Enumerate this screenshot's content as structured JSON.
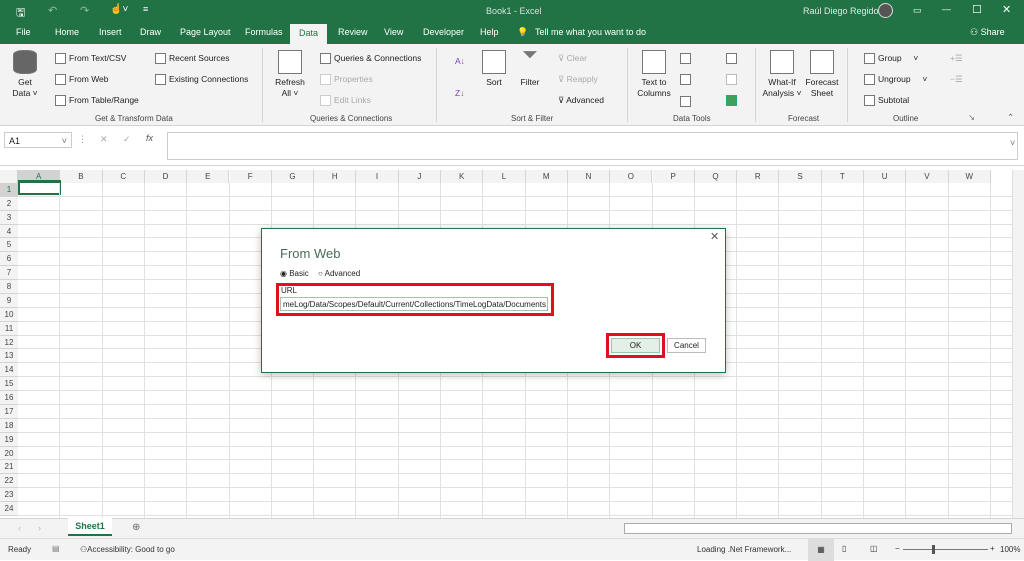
{
  "title": {
    "document": "Book1  -  Excel",
    "user": "Raúl Diego Regidor"
  },
  "tabs": [
    "File",
    "Home",
    "Insert",
    "Draw",
    "Page Layout",
    "Formulas",
    "Data",
    "Review",
    "View",
    "Developer",
    "Help"
  ],
  "tell_me": "Tell me what you want to do",
  "share": "Share",
  "ribbon": {
    "get_data": "Get Data ˅",
    "from_text": "From Text/CSV",
    "from_web": "From Web",
    "from_table": "From Table/Range",
    "recent": "Recent Sources",
    "existing": "Existing Connections",
    "g_transform": "Get & Transform Data",
    "refresh": "Refresh All ˅",
    "queries": "Queries & Connections",
    "properties": "Properties",
    "edit_links": "Edit Links",
    "g_queries": "Queries & Connections",
    "sort": "Sort",
    "filter": "Filter",
    "clear": "Clear",
    "reapply": "Reapply",
    "advanced": "Advanced",
    "g_sort": "Sort & Filter",
    "text_to_columns": "Text to Columns",
    "g_tools": "Data Tools",
    "whatif": "What-If Analysis ˅",
    "forecast_sheet": "Forecast Sheet",
    "g_forecast": "Forecast",
    "group": "Group",
    "ungroup": "Ungroup",
    "subtotal": "Subtotal",
    "g_outline": "Outline"
  },
  "namebox": "A1",
  "columns": [
    "A",
    "B",
    "C",
    "D",
    "E",
    "F",
    "G",
    "H",
    "I",
    "J",
    "K",
    "L",
    "M",
    "N",
    "O",
    "P",
    "Q",
    "R",
    "S",
    "T",
    "U",
    "V",
    "W"
  ],
  "rows": [
    "1",
    "2",
    "3",
    "4",
    "5",
    "6",
    "7",
    "8",
    "9",
    "10",
    "11",
    "12",
    "13",
    "14",
    "15",
    "16",
    "17",
    "18",
    "19",
    "20",
    "21",
    "22",
    "23",
    "24"
  ],
  "sheet_tab": "Sheet1",
  "status": {
    "ready": "Ready",
    "accessibility": "Accessibility: Good to go",
    "loading": "Loading .Net Framework...",
    "zoom": "100%"
  },
  "dialog": {
    "title": "From Web",
    "basic": "Basic",
    "advanced": "Advanced",
    "url_label": "URL",
    "url_value": "meLog/Data/Scopes/Default/Current/Collections/TimeLogData/Documents",
    "ok": "OK",
    "cancel": "Cancel",
    "selected_mode": "Basic"
  },
  "colors": {
    "brand": "#217346",
    "highlight": "#e0101e"
  }
}
